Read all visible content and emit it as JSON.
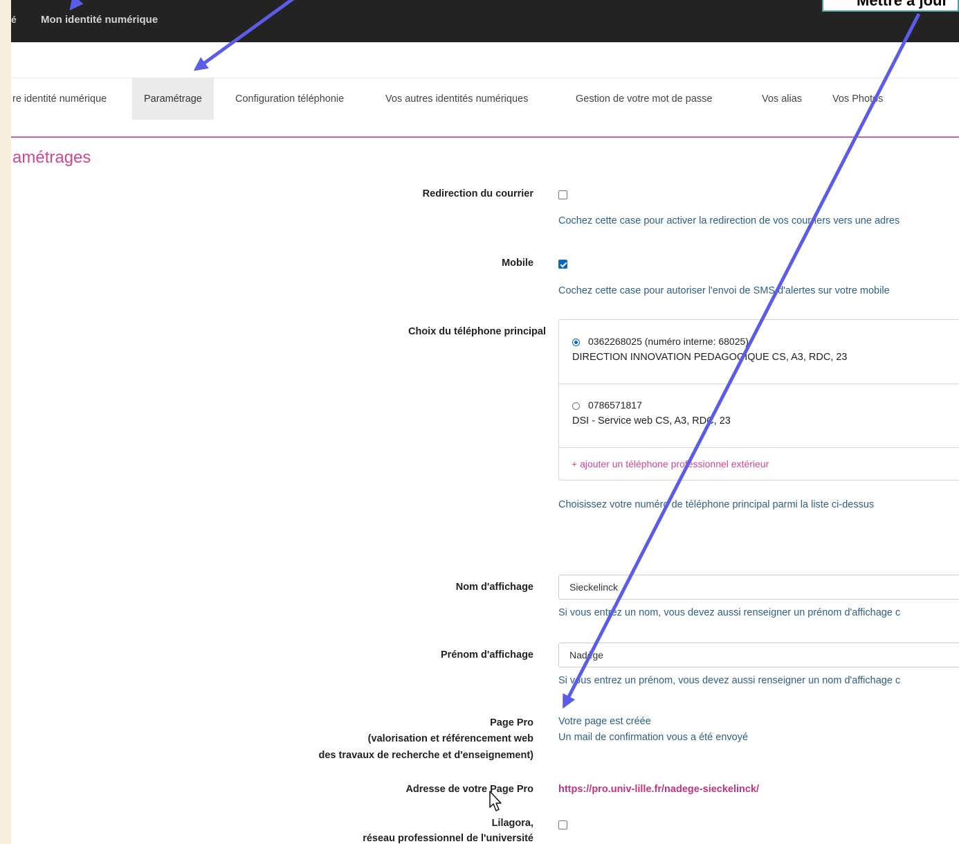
{
  "topbar": {
    "brand_glyph": "é",
    "title": "Mon identité numérique"
  },
  "callout": {
    "text": "Mettre à jour"
  },
  "tabs": [
    {
      "label": "re identité numérique",
      "active": false
    },
    {
      "label": "Paramétrage",
      "active": true
    },
    {
      "label": "Configuration téléphonie",
      "active": false
    },
    {
      "label": "Vos autres identités numériques",
      "active": false
    },
    {
      "label": "Gestion de votre mot de passe",
      "active": false
    },
    {
      "label": "Vos alias",
      "active": false
    },
    {
      "label": "Vos Photos",
      "active": false
    }
  ],
  "section": {
    "title": "amétrages"
  },
  "form": {
    "redirection": {
      "label": "Redirection du courrier",
      "checked": false,
      "help": "Cochez cette case pour activer la redirection de vos courriers vers une adres"
    },
    "mobile": {
      "label": "Mobile",
      "checked": true,
      "help": "Cochez cette case pour autoriser l'envoi de SMS d'alertes sur votre mobile"
    },
    "phone": {
      "label": "Choix du téléphone principal",
      "options": [
        {
          "number": "0362268025 (numéro interne: 68025)",
          "location": "DIRECTION INNOVATION PEDAGOGIQUE CS, A3, RDC, 23",
          "selected": true
        },
        {
          "number": "0786571817",
          "location": "DSI - Service web CS, A3, RDC, 23",
          "selected": false
        }
      ],
      "add_label": "+ ajouter un téléphone professionnel extérieur",
      "help": "Choisissez votre numéro de téléphone principal parmi la liste ci-dessus"
    },
    "display_name": {
      "label": "Nom d'affichage",
      "value": "Sieckelinck",
      "help": "Si vous entrez un nom, vous devez aussi renseigner un prénom d'affichage c"
    },
    "display_firstname": {
      "label": "Prénom d'affichage",
      "value": "Nadège",
      "help": "Si vous entrez un prénom, vous devez aussi renseigner un nom d'affichage c"
    },
    "page_pro": {
      "label_line1": "Page Pro",
      "label_line2": "(valorisation et référencement web",
      "label_line3": "des travaux de recherche et d'enseignement)",
      "status_line1": "Votre page est créée",
      "status_line2": "Un mail de confirmation vous a été envoyé"
    },
    "page_pro_address": {
      "label": "Adresse de votre Page Pro",
      "url": "https://pro.univ-lille.fr/nadege-sieckelinck/"
    },
    "lilagora": {
      "label_line1": "Lilagora,",
      "label_line2": "réseau professionnel de l'université",
      "checked": false
    }
  },
  "colors": {
    "accent": "#d0468f",
    "help_text": "#2e5f86",
    "arrow": "#5b5de8",
    "topbar": "#232323"
  }
}
